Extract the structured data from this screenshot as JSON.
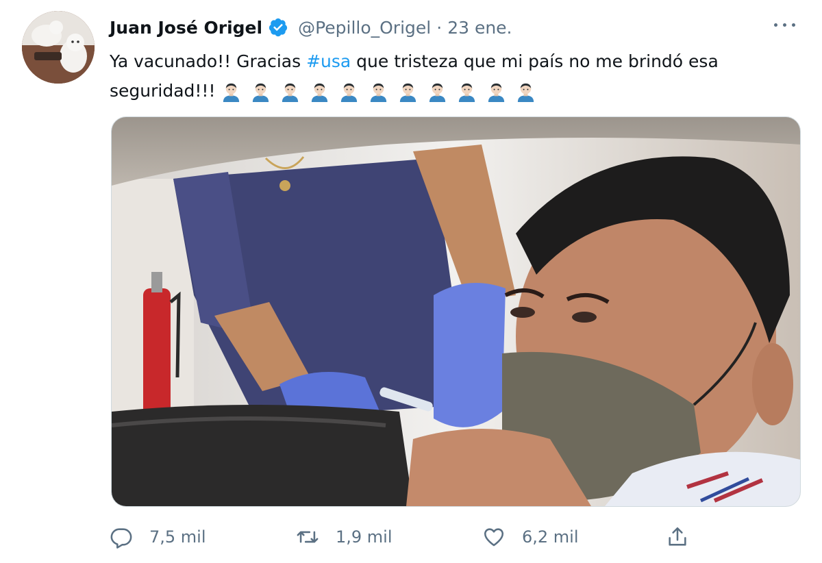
{
  "tweet": {
    "author_name": "Juan José Origel",
    "handle": "@Pepillo_Origel",
    "separator": "·",
    "date": "23 ene.",
    "text_part1": "Ya vacunado!! Gracias ",
    "hashtag": "#usa",
    "text_part2": " que tristeza que mi país no me brindó esa seguridad!!!",
    "emoji_name": "man-medium-light-skin-tone-emoji",
    "emoji_count": 11
  },
  "actions": {
    "reply_count": "7,5 mil",
    "retweet_count": "1,9 mil",
    "like_count": "6,2 mil"
  },
  "icons": {
    "verified": "verified-badge-icon",
    "more": "more-horizontal-icon",
    "reply": "reply-icon",
    "retweet": "retweet-icon",
    "like": "heart-icon",
    "share": "share-icon"
  },
  "colors": {
    "accent": "#1d9bf0",
    "muted": "#5b7083",
    "text": "#0f1419"
  }
}
